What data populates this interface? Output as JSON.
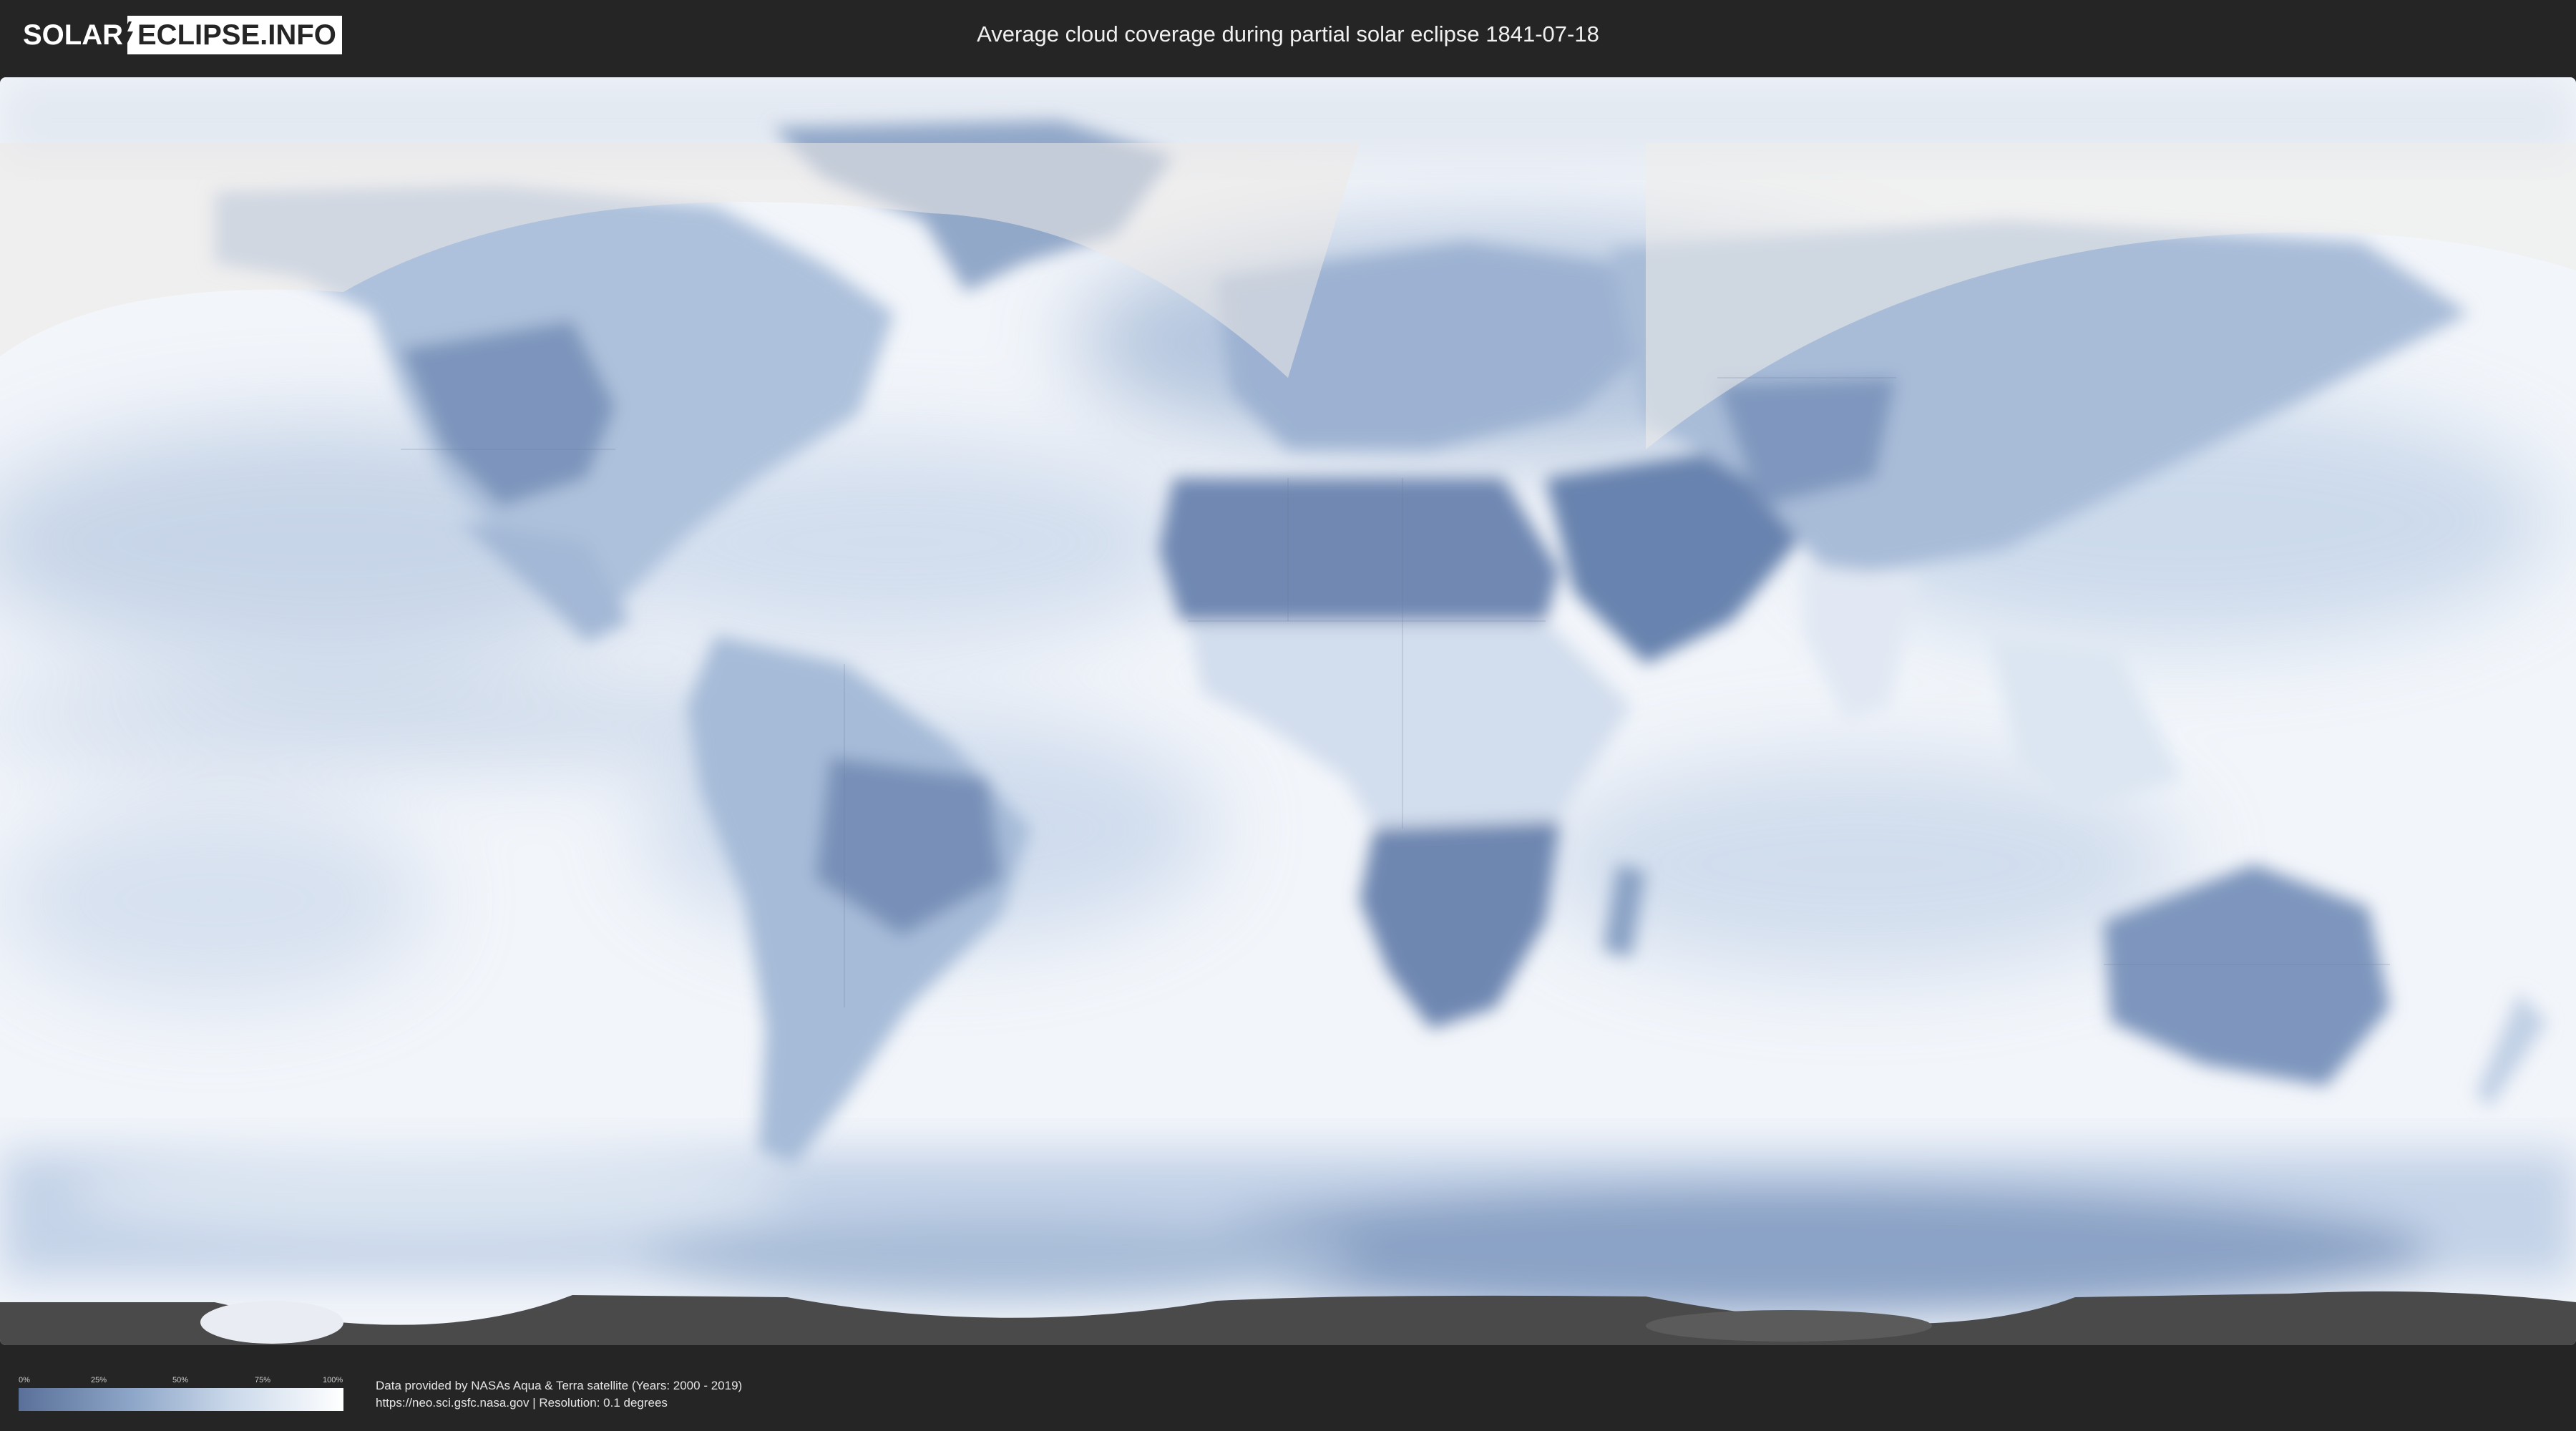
{
  "header": {
    "logo_left": "SOLAR",
    "logo_right": "ECLIPSE.INFO",
    "title": "Average cloud coverage during partial solar eclipse 1841-07-18"
  },
  "map": {
    "description_icon": "world-cloud-coverage-map",
    "colors": {
      "ocean_cloudy": "#f2f5fa",
      "clear_sky": "#5a7099",
      "mid_cover": "#a9bdd8",
      "eclipse_shade": "#e8e6e4",
      "night_band": "#4a4a4a"
    }
  },
  "legend": {
    "ticks": [
      "0%",
      "25%",
      "50%",
      "75%",
      "100%"
    ],
    "colors": [
      "#5a7099",
      "#ffffff"
    ]
  },
  "footer": {
    "line1": "Data provided by NASAs Aqua & Terra satellite (Years: 2000 - 2019)",
    "line2": "https://neo.sci.gsfc.nasa.gov | Resolution: 0.1 degrees"
  }
}
